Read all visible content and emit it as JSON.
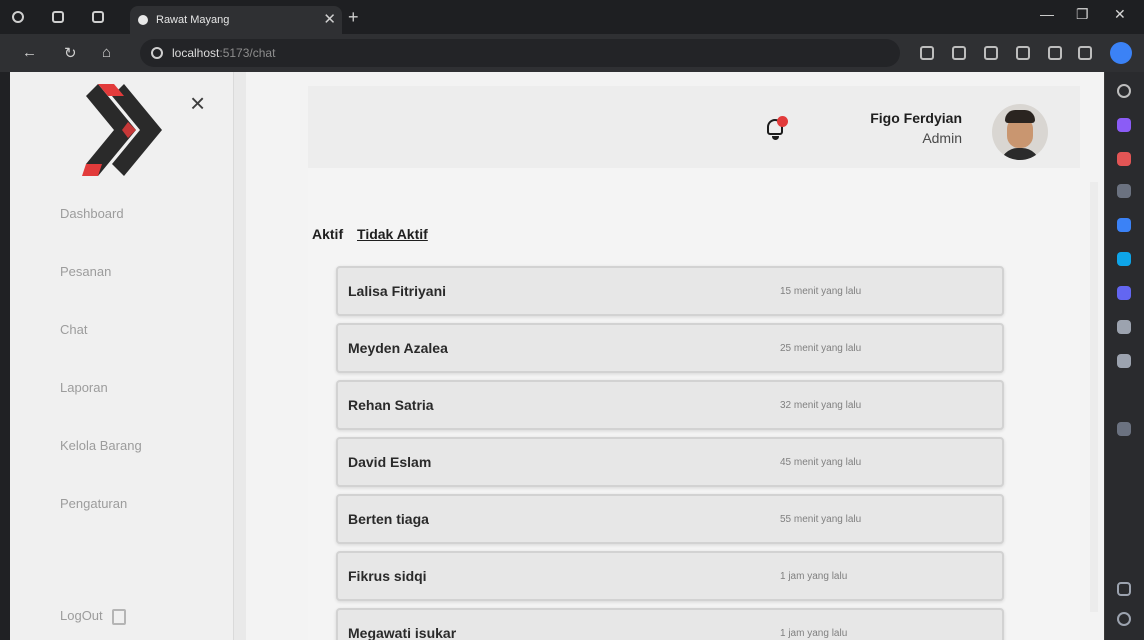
{
  "browser": {
    "tab_title": "Rawat Mayang",
    "address_host": "localhost",
    "address_path": ":5173/chat"
  },
  "sidebar": {
    "menu": [
      {
        "label": "Dashboard"
      },
      {
        "label": "Pesanan"
      },
      {
        "label": "Chat"
      },
      {
        "label": "Laporan"
      },
      {
        "label": "Kelola Barang"
      },
      {
        "label": "Pengaturan"
      }
    ],
    "logout_label": "LogOut"
  },
  "header": {
    "user_name": "Figo Ferdyian",
    "user_role": "Admin"
  },
  "tabs": {
    "active_label": "Aktif",
    "inactive_label": "Tidak Aktif"
  },
  "conversations": [
    {
      "name": "Lalisa Fitriyani",
      "time": "15 menit yang lalu"
    },
    {
      "name": "Meyden Azalea",
      "time": "25 menit yang lalu"
    },
    {
      "name": "Rehan Satria",
      "time": "32 menit yang lalu"
    },
    {
      "name": "David Eslam",
      "time": "45 menit yang lalu"
    },
    {
      "name": "Berten tiaga",
      "time": "55 menit yang lalu"
    },
    {
      "name": "Fikrus sidqi",
      "time": "1 jam yang lalu"
    },
    {
      "name": "Megawati isukar",
      "time": "1 jam yang lalu"
    }
  ],
  "colors": {
    "accent_red": "#e23b3b",
    "logo_dark": "#2a2a2a"
  }
}
